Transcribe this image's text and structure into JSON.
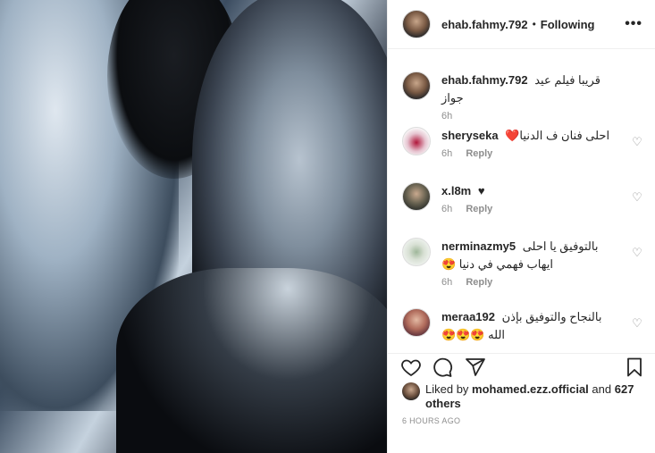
{
  "post": {
    "image_alt": "Black-and-white film poster of a man and a woman"
  },
  "header": {
    "username": "ehab.fahmy.792",
    "separator": "•",
    "follow_label": "Following",
    "more_label": "•••"
  },
  "caption": {
    "username": "ehab.fahmy.792",
    "text": "قريبا فيلم عيد جواز",
    "time": "6h"
  },
  "comments": [
    {
      "username": "sheryseka",
      "text": "احلى فنان ف الدنيا❤️",
      "time": "6h",
      "reply": "Reply"
    },
    {
      "username": "x.l8m",
      "text": "♥",
      "time": "6h",
      "reply": "Reply"
    },
    {
      "username": "nerminazmy5",
      "text": "بالتوفيق يا احلى ايهاب فهمي في دنيا 😍",
      "time": "6h",
      "reply": "Reply"
    },
    {
      "username": "meraa192",
      "text": "بالنجاح والتوفيق بإذن الله 😍😍😍",
      "time": "",
      "reply": ""
    }
  ],
  "likes": {
    "prefix": "Liked by",
    "user": "mohamed.ezz.official",
    "suffix": "and",
    "others": "627 others"
  },
  "timeago": "6 HOURS AGO",
  "icons": [
    "heart-icon",
    "comment-icon",
    "share-icon",
    "bookmark-icon",
    "more-icon"
  ]
}
